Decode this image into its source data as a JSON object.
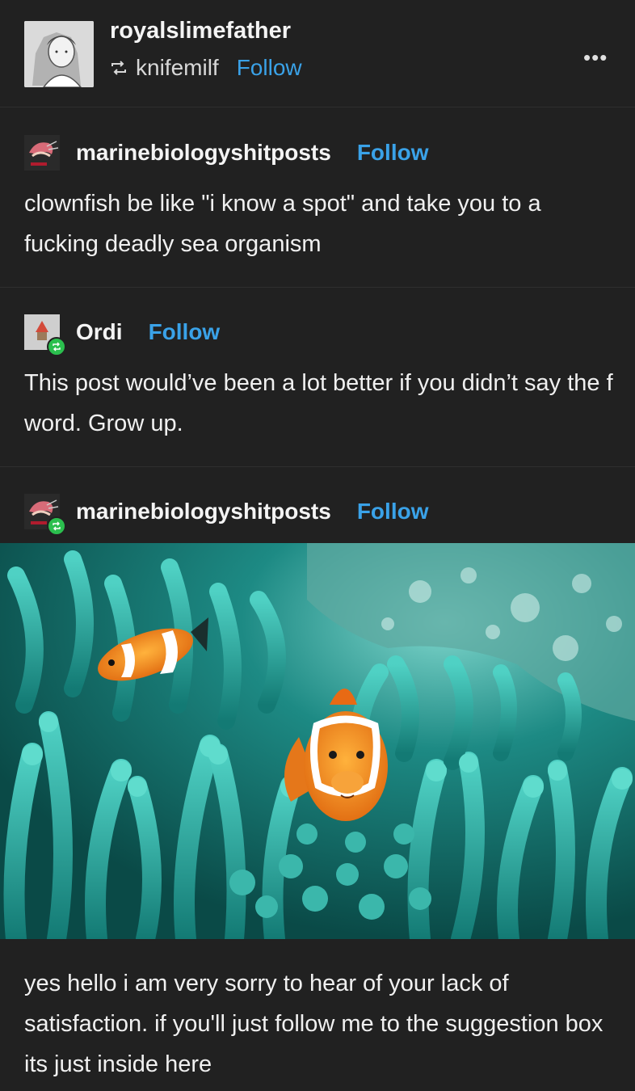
{
  "header": {
    "poster": "royalslimefather",
    "reblogged_from": "knifemilf",
    "follow_label": "Follow",
    "more_label": "•••"
  },
  "posts": [
    {
      "user": "marinebiologyshitposts",
      "follow_label": "Follow",
      "text": "clownfish be like \"i know a spot\" and take you to a fucking deadly sea organism"
    },
    {
      "user": "Ordi",
      "follow_label": "Follow",
      "text": "This post would’ve been a lot better if you didn’t say the f word. Grow up."
    },
    {
      "user": "marinebiologyshitposts",
      "follow_label": "Follow",
      "text": "yes hello i am very sorry to hear of your lack of satisfaction. if you'll just follow me to the suggestion box its just inside here"
    }
  ],
  "colors": {
    "background": "#212121",
    "link": "#3aa2e8",
    "reblog_badge": "#2bbf4e",
    "anemone": "#1f9e95",
    "clownfish": "#f08a1c"
  }
}
